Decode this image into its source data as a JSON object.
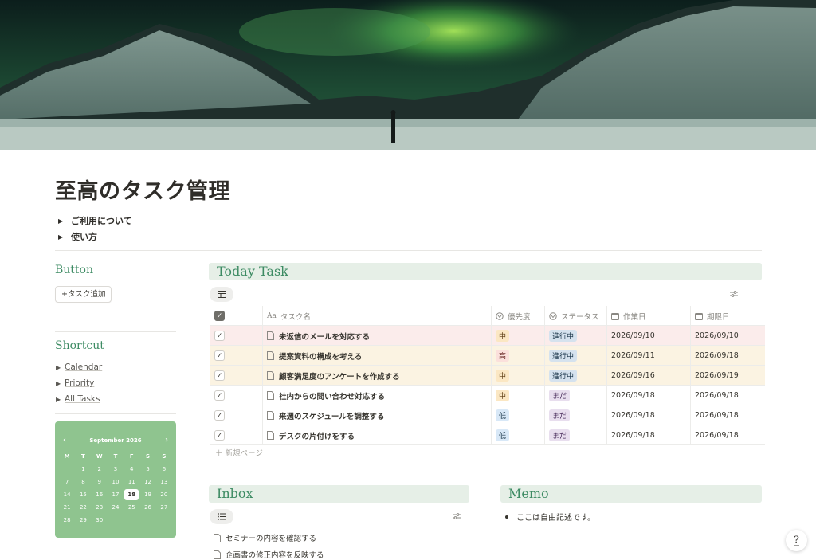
{
  "page": {
    "title": "至高のタスク管理",
    "toggles": [
      "ご利用について",
      "使い方"
    ]
  },
  "sidebar": {
    "button_heading": "Button",
    "add_task_label": "+タスク追加",
    "shortcut_heading": "Shortcut",
    "shortcuts": [
      "Calendar",
      "Priority",
      "All Tasks"
    ]
  },
  "calendar": {
    "month_label": "September 2026",
    "weekdays": [
      "M",
      "T",
      "W",
      "T",
      "F",
      "S",
      "S"
    ],
    "weeks": [
      [
        "",
        "1",
        "2",
        "3",
        "4",
        "5",
        "6"
      ],
      [
        "7",
        "8",
        "9",
        "10",
        "11",
        "12",
        "13"
      ],
      [
        "14",
        "15",
        "16",
        "17",
        "18",
        "19",
        "20"
      ],
      [
        "21",
        "22",
        "23",
        "24",
        "25",
        "26",
        "27"
      ],
      [
        "28",
        "29",
        "30",
        "",
        "",
        "",
        ""
      ]
    ],
    "today": "18"
  },
  "today_task": {
    "heading": "Today Task",
    "columns": {
      "name": "タスク名",
      "priority": "優先度",
      "status": "ステータス",
      "work_date": "作業日",
      "due_date": "期限日"
    },
    "rows": [
      {
        "done": "✓",
        "name": "未返信のメールを対応する",
        "priority": "中",
        "status": "進行中",
        "work_date": "2026/09/10",
        "due_date": "2026/09/10",
        "row_bg": "#fbeceb"
      },
      {
        "done": "✓",
        "name": "提案資料の構成を考える",
        "priority": "高",
        "status": "進行中",
        "work_date": "2026/09/11",
        "due_date": "2026/09/18",
        "row_bg": "#fbf3e2"
      },
      {
        "done": "✓",
        "name": "顧客満足度のアンケートを作成する",
        "priority": "中",
        "status": "進行中",
        "work_date": "2026/09/16",
        "due_date": "2026/09/19",
        "row_bg": "#fbf3e2"
      },
      {
        "done": "✓",
        "name": "社内からの問い合わせ対応する",
        "priority": "中",
        "status": "まだ",
        "work_date": "2026/09/18",
        "due_date": "2026/09/18",
        "row_bg": "#ffffff"
      },
      {
        "done": "✓",
        "name": "来週のスケジュールを調整する",
        "priority": "低",
        "status": "まだ",
        "work_date": "2026/09/18",
        "due_date": "2026/09/18",
        "row_bg": "#ffffff"
      },
      {
        "done": "✓",
        "name": "デスクの片付けをする",
        "priority": "低",
        "status": "まだ",
        "work_date": "2026/09/18",
        "due_date": "2026/09/18",
        "row_bg": "#ffffff"
      }
    ],
    "new_page_label": "＋ 新規ページ"
  },
  "tag_colors": {
    "高": {
      "bg": "#fbe0dc",
      "fg": "#5d1715"
    },
    "中": {
      "bg": "#fbe7c3",
      "fg": "#5c3b12"
    },
    "低": {
      "bg": "#d8e8f7",
      "fg": "#183347"
    },
    "進行中": {
      "bg": "#d5e2ee",
      "fg": "#183347"
    },
    "まだ": {
      "bg": "#e8deee",
      "fg": "#412454"
    }
  },
  "inbox": {
    "heading": "Inbox",
    "items": [
      "セミナーの内容を確認する",
      "企画書の修正内容を反映する"
    ]
  },
  "memo": {
    "heading": "Memo",
    "items": [
      "ここは自由記述です。"
    ]
  },
  "colors": {
    "accent_green": "#3d8b63",
    "section_bg": "#e6efe7",
    "calendar_bg": "#8fc48f"
  }
}
